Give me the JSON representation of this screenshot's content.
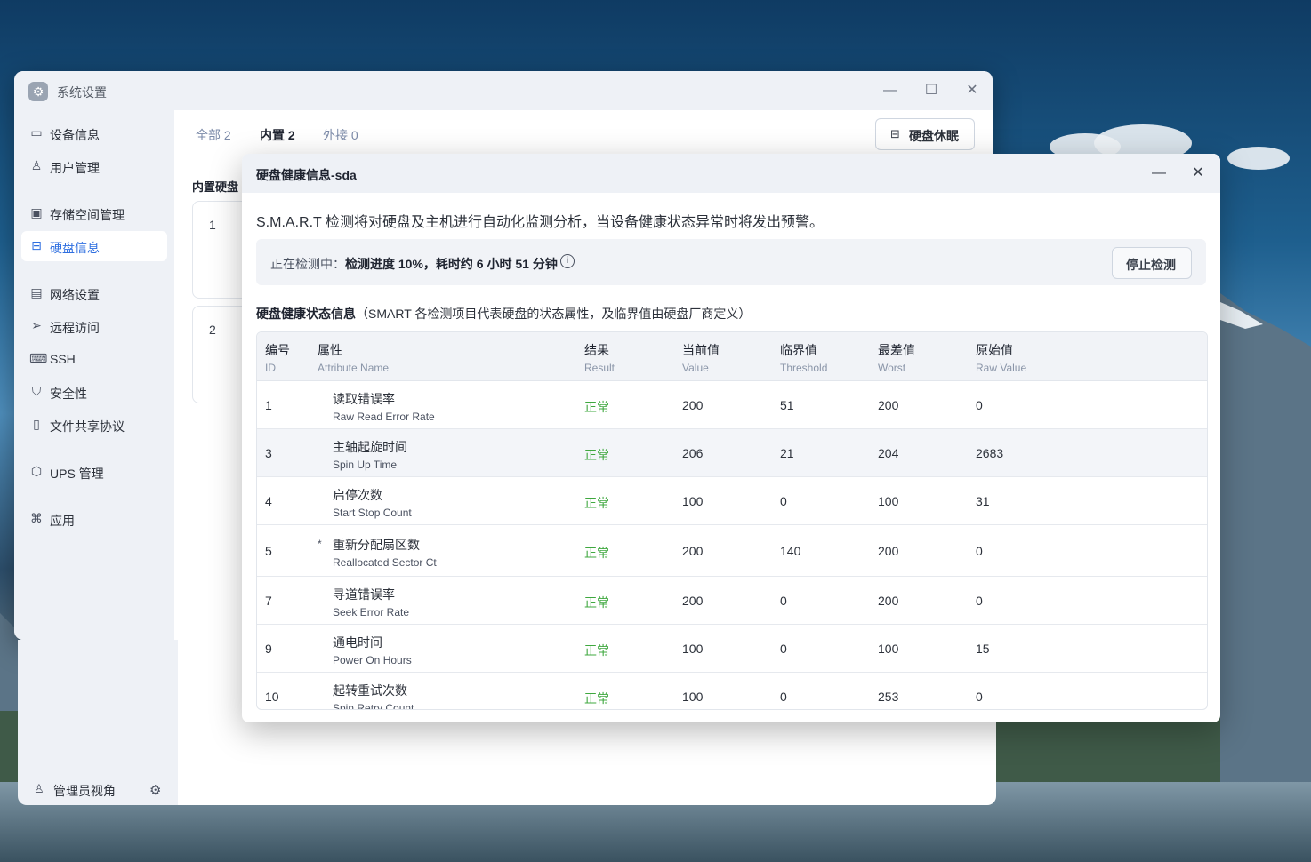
{
  "window": {
    "title": "系统设置"
  },
  "sidebar": {
    "items": [
      {
        "label": "设备信息",
        "icon": "device-icon"
      },
      {
        "label": "用户管理",
        "icon": "user-icon"
      },
      {
        "label": "存储空间管理",
        "icon": "storage-icon"
      },
      {
        "label": "硬盘信息",
        "icon": "disk-icon"
      },
      {
        "label": "网络设置",
        "icon": "network-icon"
      },
      {
        "label": "远程访问",
        "icon": "send-icon"
      },
      {
        "label": "SSH",
        "icon": "terminal-icon"
      },
      {
        "label": "安全性",
        "icon": "shield-icon"
      },
      {
        "label": "文件共享协议",
        "icon": "file-icon"
      },
      {
        "label": "UPS 管理",
        "icon": "ups-icon"
      },
      {
        "label": "应用",
        "icon": "apps-icon"
      }
    ],
    "active_label": "硬盘信息",
    "footer": {
      "admin_label": "管理员视角"
    }
  },
  "main": {
    "tabs": [
      {
        "label": "全部 2"
      },
      {
        "label": "内置 2"
      },
      {
        "label": "外接 0"
      }
    ],
    "selected_tab": "内置 2",
    "sleep_button": "硬盘休眠",
    "section_heading": "内置硬盘",
    "disk_cards": [
      {
        "num": "1"
      },
      {
        "num": "2"
      }
    ]
  },
  "dialog": {
    "title": "硬盘健康信息-sda",
    "description": "S.M.A.R.T 检测将对硬盘及主机进行自动化监测分析，当设备健康状态异常时将发出预警。",
    "progress": {
      "label": "正在检测中：",
      "text": "检测进度 10%，耗时约 6 小时 51 分钟",
      "percent": 10
    },
    "stop_button": "停止检测",
    "health_title_bold": "硬盘健康状态信息",
    "health_title_note": "（SMART 各检测项目代表硬盘的状态属性，及临界值由硬盘厂商定义）",
    "table": {
      "headers": [
        {
          "zh": "编号",
          "en": "ID"
        },
        {
          "zh": "属性",
          "en": "Attribute Name"
        },
        {
          "zh": "结果",
          "en": "Result"
        },
        {
          "zh": "当前值",
          "en": "Value"
        },
        {
          "zh": "临界值",
          "en": "Threshold"
        },
        {
          "zh": "最差值",
          "en": "Worst"
        },
        {
          "zh": "原始值",
          "en": "Raw Value"
        }
      ],
      "rows": [
        {
          "id": "1",
          "zh": "读取错误率",
          "en": "Raw Read Error Rate",
          "star": "",
          "result": "正常",
          "value": "200",
          "threshold": "51",
          "worst": "200",
          "raw": "0"
        },
        {
          "id": "3",
          "zh": "主轴起旋时间",
          "en": "Spin Up Time",
          "star": "",
          "result": "正常",
          "value": "206",
          "threshold": "21",
          "worst": "204",
          "raw": "2683"
        },
        {
          "id": "4",
          "zh": "启停次数",
          "en": "Start Stop Count",
          "star": "",
          "result": "正常",
          "value": "100",
          "threshold": "0",
          "worst": "100",
          "raw": "31"
        },
        {
          "id": "5",
          "zh": "重新分配扇区数",
          "en": "Reallocated Sector Ct",
          "star": "*",
          "result": "正常",
          "value": "200",
          "threshold": "140",
          "worst": "200",
          "raw": "0"
        },
        {
          "id": "7",
          "zh": "寻道错误率",
          "en": "Seek Error Rate",
          "star": "",
          "result": "正常",
          "value": "200",
          "threshold": "0",
          "worst": "200",
          "raw": "0"
        },
        {
          "id": "9",
          "zh": "通电时间",
          "en": "Power On Hours",
          "star": "",
          "result": "正常",
          "value": "100",
          "threshold": "0",
          "worst": "100",
          "raw": "15"
        },
        {
          "id": "10",
          "zh": "起转重试次数",
          "en": "Spin Retry Count",
          "star": "",
          "result": "正常",
          "value": "100",
          "threshold": "0",
          "worst": "253",
          "raw": "0"
        }
      ]
    }
  },
  "colors": {
    "accent": "#2f6fe0",
    "ok": "#3fa83f"
  }
}
